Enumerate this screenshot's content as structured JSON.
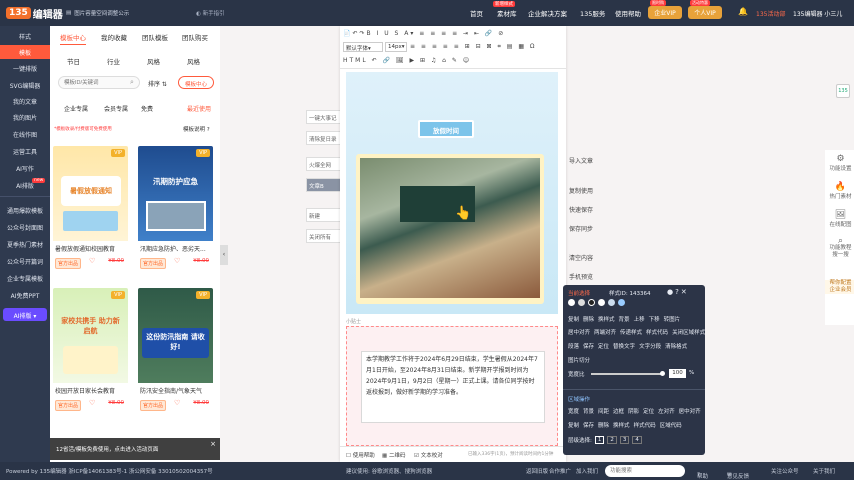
{
  "topbar": {
    "logo_num": "135",
    "logo_text": "编辑器",
    "notice": "图片容量空间调整公示",
    "new_version": "新手指引",
    "nav": [
      "首页",
      "素材库",
      "企业解决方案",
      "135服务",
      "使用帮助"
    ],
    "nav_badge": "新增样式",
    "enterprise_vip": "企业VIP",
    "personal_vip": "个人VIP",
    "enterprise_badge": "限时购",
    "personal_badge": "活动特惠",
    "user_prefix": "135活动部",
    "user_name": "135编辑器 小三儿"
  },
  "sidebar": {
    "items": [
      "样式",
      "模板",
      "一键排版",
      "SVG编辑器",
      "我的文章",
      "我的图片",
      "在线作图",
      "运营工具",
      "AI写作",
      "AI排版",
      "通用爆款模板",
      "公众号封面图",
      "夏季热门素材",
      "公众号开篇词",
      "企业专属模板",
      "AI免费PPT"
    ],
    "ai_label": "AI排版",
    "new_badge": "new"
  },
  "template_panel": {
    "tabs": [
      "模板中心",
      "我的收藏",
      "团队模板",
      "团队购买"
    ],
    "filters": [
      "节日",
      "行业",
      "风格",
      "风格"
    ],
    "search_placeholder": "模板ID/关键词",
    "sort_label": "排序",
    "center_label": "模板中心",
    "subtabs": [
      "企业专属",
      "会员专属",
      "免费",
      "最近使用"
    ],
    "hint": "*模板收录/付费版可免费使用",
    "guide": "模板说明",
    "cards": [
      {
        "title": "暑假放假通知校园教育",
        "badge": "官方出品",
        "price": "¥8.00",
        "vip": "VIP",
        "thumb_text": "暑假放假通知"
      },
      {
        "title": "汛期应急防护、恶劣天...",
        "badge": "官方出品",
        "price": "¥8.00",
        "vip": "VIP",
        "thumb_text": "汛期防护应急"
      },
      {
        "title": "校园开放日家长会教育",
        "badge": "官方出品",
        "price": "¥8.00",
        "vip": "VIP",
        "thumb_text": "家校共携手 助力新启航"
      },
      {
        "title": "防汛安全指南/气象天气",
        "badge": "官方出品",
        "price": "¥8.00",
        "vip": "VIP",
        "thumb_text": "这份防汛指南 请收好!"
      }
    ],
    "toast": "12省活/模板免费使用，点击进入活动页面"
  },
  "editor": {
    "font_select": "默认字体",
    "size_select": "14px",
    "banner_text": "放假时间",
    "paragraph": "本学期教学工作将于2024年6月29日结束，学生暑假从2024年7月1日开始，至2024年8月31日结束。新学期开学报到时间为2024年9月1日，9月2日（星期一）正式上课。请各位同学按时返校报到，做好新学期的学习准备。",
    "section_label": "小贴士",
    "bottom_tools": [
      "使用帮助",
      "二维码",
      "文本校对"
    ],
    "word_count": "已输入336字(1页)，预计阅读时间约1分钟"
  },
  "left_buttons": [
    "一键大事记",
    "清除复日录",
    "火爆全网",
    "文章B",
    "新建",
    "关闭所有"
  ],
  "right_buttons": [
    "导入文章",
    "复制使用",
    "快速保存",
    "保存同步",
    "清空内容",
    "手机预览"
  ],
  "popover": {
    "title": "当前选择",
    "id_label": "样式ID: 143364",
    "row1": [
      "复制",
      "删除",
      "换样式",
      "背景",
      "上移",
      "下移",
      "转图片"
    ],
    "row2": [
      "居中对齐",
      "两端对齐",
      "传递样式",
      "样式代码",
      "关闭区域样式"
    ],
    "row3": [
      "段落",
      "保存",
      "定位",
      "替换文字",
      "文字分段",
      "清除格式"
    ],
    "row4": "图片切分",
    "width_label": "宽度比",
    "width_value": "100",
    "pct": "%",
    "area_title": "区域操作",
    "row5": [
      "宽度",
      "背景",
      "间距",
      "边框",
      "阴影",
      "定位",
      "左对齐",
      "居中对齐"
    ],
    "row6": [
      "复制",
      "保存",
      "删除",
      "换样式",
      "样式代码",
      "区域代码"
    ],
    "level_label": "层级选择:",
    "levels": [
      "1",
      "2",
      "3",
      "4"
    ]
  },
  "right_toolbar": [
    "功能设置",
    "热门素材",
    "在线配图",
    "功能教程\n搜一搜",
    "帮你配置\n企业会员"
  ],
  "bottom": {
    "powered": "Powered by 135编辑器 浙ICP备14061383号-1 浙公网安备 33010502004357号",
    "tips": "建议使用: 谷歌浏览器、搜狗浏览器",
    "back": "返回旧版",
    "partner": "合作推广",
    "join": "加入我们",
    "search_placeholder": "功能搜索",
    "help": "帮助",
    "feedback": "意见反馈",
    "wechat": "关注公众号",
    "about": "关于我们"
  },
  "colors": {
    "brand": "#ff5a3c",
    "topbar": "#2a3447",
    "sidebar": "#2f3a4f",
    "vip": "#f3b12b"
  }
}
